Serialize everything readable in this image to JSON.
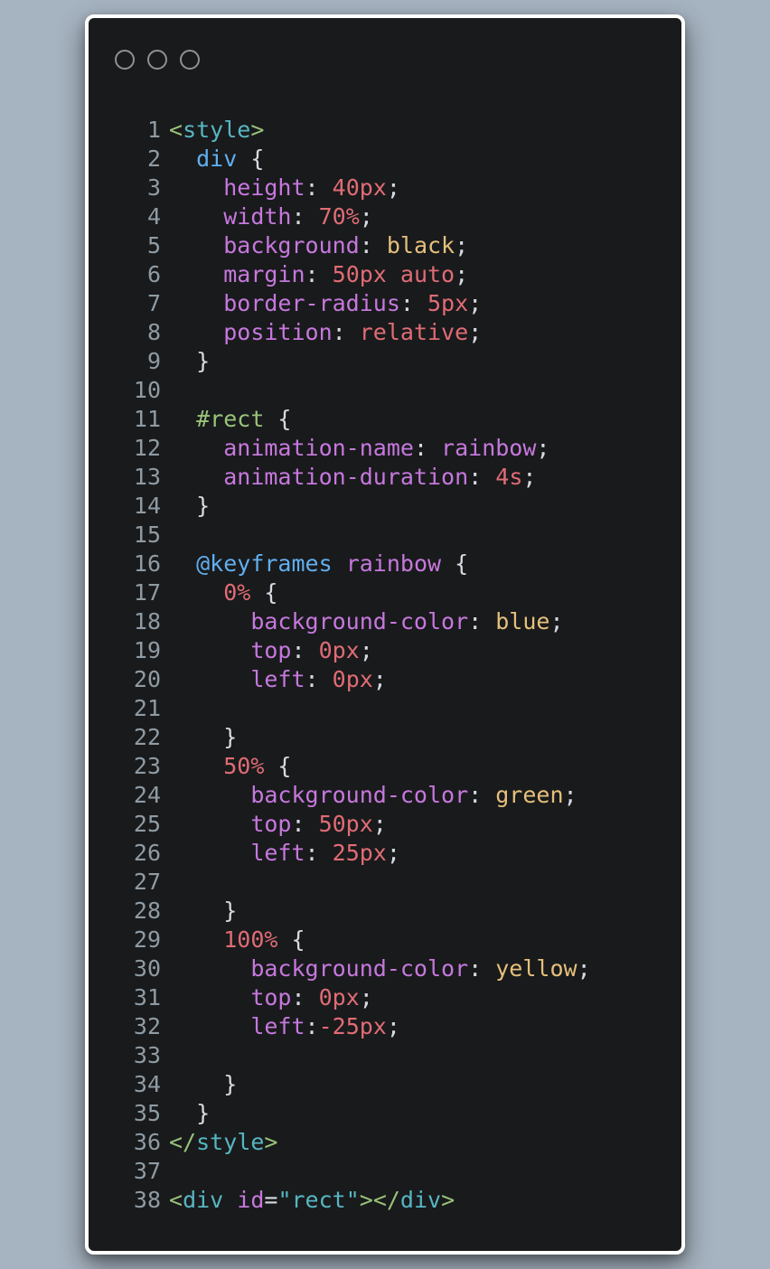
{
  "window": {
    "controls": [
      "circle-1",
      "circle-2",
      "circle-3"
    ]
  },
  "code": {
    "lines": [
      {
        "n": "1",
        "tokens": [
          {
            "t": "<",
            "c": "tag"
          },
          {
            "t": "style",
            "c": "tagname"
          },
          {
            "t": ">",
            "c": "tag"
          }
        ]
      },
      {
        "n": "2",
        "tokens": [
          {
            "t": "  ",
            "c": "punc"
          },
          {
            "t": "div",
            "c": "sel"
          },
          {
            "t": " {",
            "c": "punc"
          }
        ]
      },
      {
        "n": "3",
        "tokens": [
          {
            "t": "    ",
            "c": "punc"
          },
          {
            "t": "height",
            "c": "prop"
          },
          {
            "t": ": ",
            "c": "punc"
          },
          {
            "t": "40px",
            "c": "num"
          },
          {
            "t": ";",
            "c": "punc"
          }
        ]
      },
      {
        "n": "4",
        "tokens": [
          {
            "t": "    ",
            "c": "punc"
          },
          {
            "t": "width",
            "c": "prop"
          },
          {
            "t": ": ",
            "c": "punc"
          },
          {
            "t": "70%",
            "c": "num"
          },
          {
            "t": ";",
            "c": "punc"
          }
        ]
      },
      {
        "n": "5",
        "tokens": [
          {
            "t": "    ",
            "c": "punc"
          },
          {
            "t": "background",
            "c": "prop"
          },
          {
            "t": ": ",
            "c": "punc"
          },
          {
            "t": "black",
            "c": "kw"
          },
          {
            "t": ";",
            "c": "punc"
          }
        ]
      },
      {
        "n": "6",
        "tokens": [
          {
            "t": "    ",
            "c": "punc"
          },
          {
            "t": "margin",
            "c": "prop"
          },
          {
            "t": ": ",
            "c": "punc"
          },
          {
            "t": "50px auto",
            "c": "num"
          },
          {
            "t": ";",
            "c": "punc"
          }
        ]
      },
      {
        "n": "7",
        "tokens": [
          {
            "t": "    ",
            "c": "punc"
          },
          {
            "t": "border-radius",
            "c": "prop"
          },
          {
            "t": ": ",
            "c": "punc"
          },
          {
            "t": "5px",
            "c": "num"
          },
          {
            "t": ";",
            "c": "punc"
          }
        ]
      },
      {
        "n": "8",
        "tokens": [
          {
            "t": "    ",
            "c": "punc"
          },
          {
            "t": "position",
            "c": "prop"
          },
          {
            "t": ": ",
            "c": "punc"
          },
          {
            "t": "relative",
            "c": "num"
          },
          {
            "t": ";",
            "c": "punc"
          }
        ]
      },
      {
        "n": "9",
        "tokens": [
          {
            "t": "  }",
            "c": "punc"
          }
        ]
      },
      {
        "n": "10",
        "tokens": []
      },
      {
        "n": "11",
        "tokens": [
          {
            "t": "  ",
            "c": "punc"
          },
          {
            "t": "#rect",
            "c": "id"
          },
          {
            "t": " {",
            "c": "punc"
          }
        ]
      },
      {
        "n": "12",
        "tokens": [
          {
            "t": "    ",
            "c": "punc"
          },
          {
            "t": "animation-name",
            "c": "prop"
          },
          {
            "t": ": ",
            "c": "punc"
          },
          {
            "t": "rainbow",
            "c": "name"
          },
          {
            "t": ";",
            "c": "punc"
          }
        ]
      },
      {
        "n": "13",
        "tokens": [
          {
            "t": "    ",
            "c": "punc"
          },
          {
            "t": "animation-duration",
            "c": "prop"
          },
          {
            "t": ": ",
            "c": "punc"
          },
          {
            "t": "4s",
            "c": "num"
          },
          {
            "t": ";",
            "c": "punc"
          }
        ]
      },
      {
        "n": "14",
        "tokens": [
          {
            "t": "  }",
            "c": "punc"
          }
        ]
      },
      {
        "n": "15",
        "tokens": []
      },
      {
        "n": "16",
        "tokens": [
          {
            "t": "  ",
            "c": "punc"
          },
          {
            "t": "@keyframes",
            "c": "at"
          },
          {
            "t": " ",
            "c": "punc"
          },
          {
            "t": "rainbow",
            "c": "name"
          },
          {
            "t": " {",
            "c": "punc"
          }
        ]
      },
      {
        "n": "17",
        "tokens": [
          {
            "t": "    ",
            "c": "punc"
          },
          {
            "t": "0%",
            "c": "num"
          },
          {
            "t": " {",
            "c": "punc"
          }
        ]
      },
      {
        "n": "18",
        "tokens": [
          {
            "t": "      ",
            "c": "punc"
          },
          {
            "t": "background-color",
            "c": "prop"
          },
          {
            "t": ": ",
            "c": "punc"
          },
          {
            "t": "blue",
            "c": "kw"
          },
          {
            "t": ";",
            "c": "punc"
          }
        ]
      },
      {
        "n": "19",
        "tokens": [
          {
            "t": "      ",
            "c": "punc"
          },
          {
            "t": "top",
            "c": "prop"
          },
          {
            "t": ": ",
            "c": "punc"
          },
          {
            "t": "0px",
            "c": "num"
          },
          {
            "t": ";",
            "c": "punc"
          }
        ]
      },
      {
        "n": "20",
        "tokens": [
          {
            "t": "      ",
            "c": "punc"
          },
          {
            "t": "left",
            "c": "prop"
          },
          {
            "t": ": ",
            "c": "punc"
          },
          {
            "t": "0px",
            "c": "num"
          },
          {
            "t": ";",
            "c": "punc"
          }
        ]
      },
      {
        "n": "21",
        "tokens": []
      },
      {
        "n": "22",
        "tokens": [
          {
            "t": "    }",
            "c": "punc"
          }
        ]
      },
      {
        "n": "23",
        "tokens": [
          {
            "t": "    ",
            "c": "punc"
          },
          {
            "t": "50%",
            "c": "num"
          },
          {
            "t": " {",
            "c": "punc"
          }
        ]
      },
      {
        "n": "24",
        "tokens": [
          {
            "t": "      ",
            "c": "punc"
          },
          {
            "t": "background-color",
            "c": "prop"
          },
          {
            "t": ": ",
            "c": "punc"
          },
          {
            "t": "green",
            "c": "kw"
          },
          {
            "t": ";",
            "c": "punc"
          }
        ]
      },
      {
        "n": "25",
        "tokens": [
          {
            "t": "      ",
            "c": "punc"
          },
          {
            "t": "top",
            "c": "prop"
          },
          {
            "t": ": ",
            "c": "punc"
          },
          {
            "t": "50px",
            "c": "num"
          },
          {
            "t": ";",
            "c": "punc"
          }
        ]
      },
      {
        "n": "26",
        "tokens": [
          {
            "t": "      ",
            "c": "punc"
          },
          {
            "t": "left",
            "c": "prop"
          },
          {
            "t": ": ",
            "c": "punc"
          },
          {
            "t": "25px",
            "c": "num"
          },
          {
            "t": ";",
            "c": "punc"
          }
        ]
      },
      {
        "n": "27",
        "tokens": []
      },
      {
        "n": "28",
        "tokens": [
          {
            "t": "    }",
            "c": "punc"
          }
        ]
      },
      {
        "n": "29",
        "tokens": [
          {
            "t": "    ",
            "c": "punc"
          },
          {
            "t": "100%",
            "c": "num"
          },
          {
            "t": " {",
            "c": "punc"
          }
        ]
      },
      {
        "n": "30",
        "tokens": [
          {
            "t": "      ",
            "c": "punc"
          },
          {
            "t": "background-color",
            "c": "prop"
          },
          {
            "t": ": ",
            "c": "punc"
          },
          {
            "t": "yellow",
            "c": "kw"
          },
          {
            "t": ";",
            "c": "punc"
          }
        ]
      },
      {
        "n": "31",
        "tokens": [
          {
            "t": "      ",
            "c": "punc"
          },
          {
            "t": "top",
            "c": "prop"
          },
          {
            "t": ": ",
            "c": "punc"
          },
          {
            "t": "0px",
            "c": "num"
          },
          {
            "t": ";",
            "c": "punc"
          }
        ]
      },
      {
        "n": "32",
        "tokens": [
          {
            "t": "      ",
            "c": "punc"
          },
          {
            "t": "left",
            "c": "prop"
          },
          {
            "t": ":",
            "c": "punc"
          },
          {
            "t": "-25px",
            "c": "num"
          },
          {
            "t": ";",
            "c": "punc"
          }
        ]
      },
      {
        "n": "33",
        "tokens": []
      },
      {
        "n": "34",
        "tokens": [
          {
            "t": "    }",
            "c": "punc"
          }
        ]
      },
      {
        "n": "35",
        "tokens": [
          {
            "t": "  }",
            "c": "punc"
          }
        ]
      },
      {
        "n": "36",
        "tokens": [
          {
            "t": "</",
            "c": "tag"
          },
          {
            "t": "style",
            "c": "tagname"
          },
          {
            "t": ">",
            "c": "tag"
          }
        ]
      },
      {
        "n": "37",
        "tokens": []
      },
      {
        "n": "38",
        "tokens": [
          {
            "t": "<",
            "c": "tag"
          },
          {
            "t": "div",
            "c": "tagname"
          },
          {
            "t": " ",
            "c": "punc"
          },
          {
            "t": "id",
            "c": "attr"
          },
          {
            "t": "=",
            "c": "punc"
          },
          {
            "t": "\"rect\"",
            "c": "str"
          },
          {
            "t": "></",
            "c": "tag"
          },
          {
            "t": "div",
            "c": "tagname"
          },
          {
            "t": ">",
            "c": "tag"
          }
        ]
      }
    ]
  },
  "colors": {
    "page_background": "#a6b3c0",
    "editor_background": "#191a1c",
    "window_border": "#ffffff",
    "line_number": "#8f9ba3"
  }
}
